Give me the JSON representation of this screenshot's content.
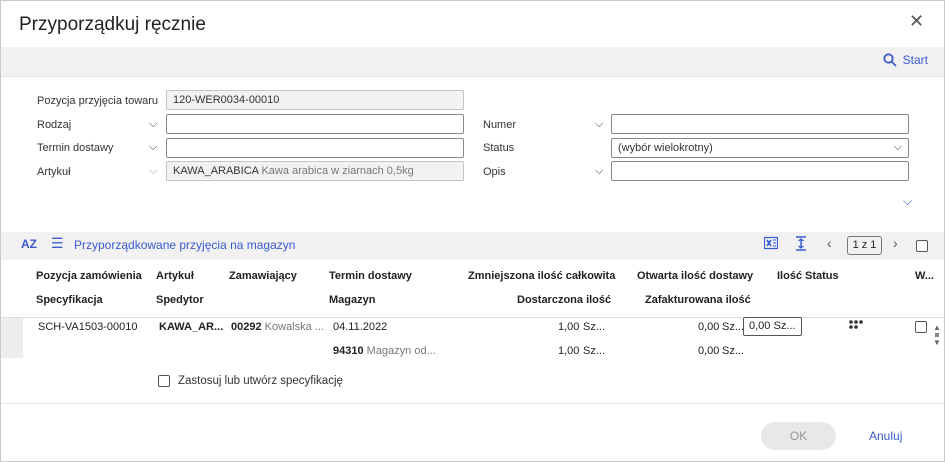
{
  "dialog": {
    "title": "Przyporządkuj ręcznie"
  },
  "toolbar": {
    "start_label": "Start"
  },
  "form": {
    "pozycja": {
      "label": "Pozycja przyjęcia towaru",
      "value": "120-WER0034-00010"
    },
    "rodzaj": {
      "label": "Rodzaj",
      "value": ""
    },
    "termin": {
      "label": "Termin dostawy",
      "value": ""
    },
    "artykul": {
      "label": "Artykuł",
      "code": "KAWA_ARABICA",
      "desc": "Kawa arabica  w ziarnach 0,5kg"
    },
    "numer": {
      "label": "Numer",
      "value": ""
    },
    "status": {
      "label": "Status",
      "value": "(wybór wielokrotny)"
    },
    "opis": {
      "label": "Opis",
      "value": ""
    }
  },
  "section": {
    "sort_icon_label": "AZ",
    "title": "Przyporządkowane przyjęcia na magazyn",
    "pager": "1 z 1"
  },
  "table": {
    "headers_row1": [
      "Pozycja zamówienia",
      "Artykuł",
      "Zamawiający",
      "Termin dostawy",
      "Zmniejszona ilość całkowita",
      "Otwarta ilość dostawy",
      "Ilość",
      "Status",
      "W..."
    ],
    "headers_row2": [
      "Specyfikacja",
      "Spedytor",
      "Magazyn",
      "Dostarczona ilość",
      "Zafakturowana ilość"
    ],
    "row": {
      "pozycja": "SCH-VA1503-00010",
      "artykul": "KAWA_AR...",
      "zamawiajacy_code": "00292",
      "zamawiajacy_name": "Kowalska ...",
      "termin": "04.11.2022",
      "zmniejszona": "1,00",
      "zmniejszona_unit": "Sz...",
      "otwarta": "0,00",
      "otwarta_unit": "Sz...",
      "ilosc": "0,00",
      "ilosc_unit": "Sz...",
      "magazyn_code": "94310",
      "magazyn_name": "Magazyn od...",
      "dostarczona": "1,00",
      "dostarczona_unit": "Sz...",
      "zafakturowana": "0,00",
      "zafakturowana_unit": "Sz..."
    }
  },
  "spec_checkbox_label": "Zastosuj lub utwórz specyfikację",
  "footer": {
    "ok_label": "OK",
    "cancel_label": "Anuluj"
  },
  "colors": {
    "accent": "#3b5bcf",
    "toolbar_bg": "#f1f1f1"
  }
}
